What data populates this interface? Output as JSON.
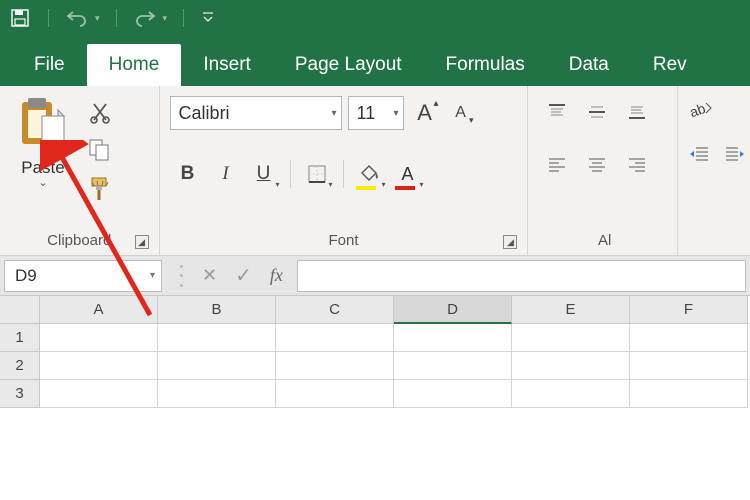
{
  "qat": {
    "save": "save-icon",
    "undo": "undo-icon",
    "redo": "redo-icon",
    "customize": "customize-icon"
  },
  "tabs": {
    "file": "File",
    "home": "Home",
    "insert": "Insert",
    "page_layout": "Page Layout",
    "formulas": "Formulas",
    "data": "Data",
    "review": "Rev"
  },
  "clipboard": {
    "paste_label": "Paste",
    "group_label": "Clipboard"
  },
  "font": {
    "name": "Calibri",
    "size": "11",
    "bold": "B",
    "italic": "I",
    "underline": "U",
    "group_label": "Font"
  },
  "alignment": {
    "group_label": "Al"
  },
  "formula_bar": {
    "cell_ref": "D9",
    "fx": "fx",
    "value": ""
  },
  "grid": {
    "cols": [
      "A",
      "B",
      "C",
      "D",
      "E",
      "F"
    ],
    "rows": [
      "1",
      "2",
      "3"
    ],
    "selected_col": "D"
  },
  "colors": {
    "brand": "#217346",
    "highlight": "#ffeb00",
    "font_color_bar": "#d62516"
  }
}
